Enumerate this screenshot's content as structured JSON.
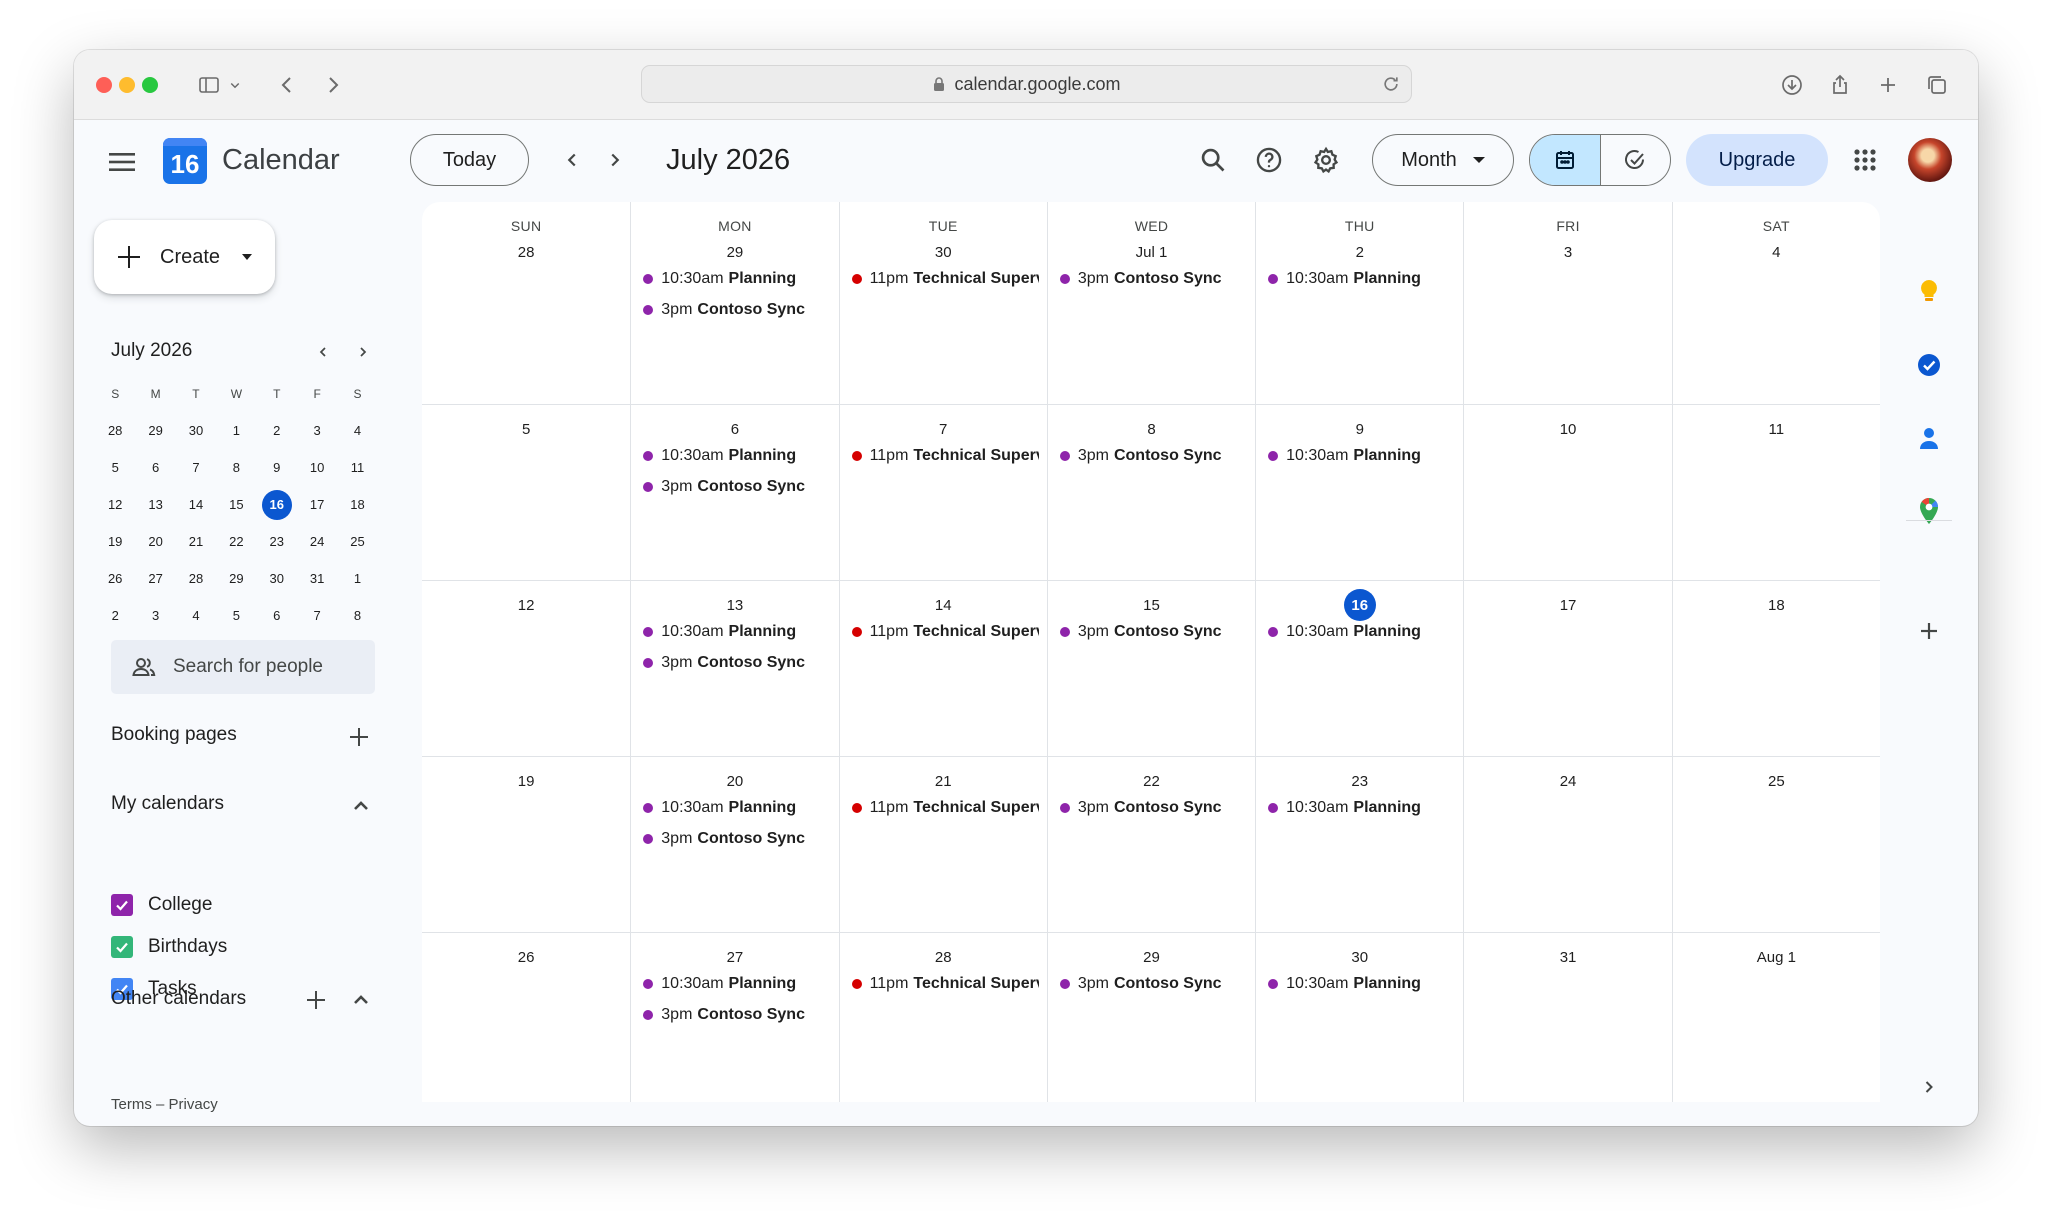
{
  "browser": {
    "url": "calendar.google.com"
  },
  "app": {
    "title": "Calendar",
    "logo_number": "16"
  },
  "header": {
    "today_label": "Today",
    "month_title": "July 2026",
    "view_label": "Month",
    "upgrade_label": "Upgrade"
  },
  "sidebar": {
    "create_label": "Create",
    "mini_month_title": "July 2026",
    "weekdays": [
      "S",
      "M",
      "T",
      "W",
      "T",
      "F",
      "S"
    ],
    "mini_weeks": [
      [
        "28",
        "29",
        "30",
        "1",
        "2",
        "3",
        "4"
      ],
      [
        "5",
        "6",
        "7",
        "8",
        "9",
        "10",
        "11"
      ],
      [
        "12",
        "13",
        "14",
        "15",
        "16",
        "17",
        "18"
      ],
      [
        "19",
        "20",
        "21",
        "22",
        "23",
        "24",
        "25"
      ],
      [
        "26",
        "27",
        "28",
        "29",
        "30",
        "31",
        "1"
      ],
      [
        "2",
        "3",
        "4",
        "5",
        "6",
        "7",
        "8"
      ]
    ],
    "mini_today": "16",
    "search_people_placeholder": "Search for people",
    "booking_pages_label": "Booking pages",
    "my_calendars_label": "My calendars",
    "my_calendars": [
      {
        "name": "College",
        "color": "#8e24aa"
      },
      {
        "name": "Birthdays",
        "color": "#33b679"
      },
      {
        "name": "Tasks",
        "color": "#4285f4"
      }
    ],
    "other_calendars_label": "Other calendars",
    "footer": {
      "terms": "Terms",
      "separator": "–",
      "privacy": "Privacy"
    }
  },
  "colors": {
    "planning": "#8e24aa",
    "contoso": "#8e24aa",
    "technical": "#d50000",
    "today": "#0b57d0"
  },
  "month_grid": {
    "weekday_headers": [
      "SUN",
      "MON",
      "TUE",
      "WED",
      "THU",
      "FRI",
      "SAT"
    ],
    "weeks": [
      [
        {
          "label": "28",
          "events": []
        },
        {
          "label": "29",
          "events": [
            {
              "time": "10:30am",
              "title": "Planning",
              "color": "#8e24aa"
            },
            {
              "time": "3pm",
              "title": "Contoso Sync",
              "color": "#8e24aa"
            }
          ]
        },
        {
          "label": "30",
          "events": [
            {
              "time": "11pm",
              "title": "Technical Superv",
              "color": "#d50000"
            }
          ]
        },
        {
          "label": "Jul 1",
          "events": [
            {
              "time": "3pm",
              "title": "Contoso Sync",
              "color": "#8e24aa"
            }
          ]
        },
        {
          "label": "2",
          "events": [
            {
              "time": "10:30am",
              "title": "Planning",
              "color": "#8e24aa"
            }
          ]
        },
        {
          "label": "3",
          "events": []
        },
        {
          "label": "4",
          "events": []
        }
      ],
      [
        {
          "label": "5",
          "events": []
        },
        {
          "label": "6",
          "events": [
            {
              "time": "10:30am",
              "title": "Planning",
              "color": "#8e24aa"
            },
            {
              "time": "3pm",
              "title": "Contoso Sync",
              "color": "#8e24aa"
            }
          ]
        },
        {
          "label": "7",
          "events": [
            {
              "time": "11pm",
              "title": "Technical Superv",
              "color": "#d50000"
            }
          ]
        },
        {
          "label": "8",
          "events": [
            {
              "time": "3pm",
              "title": "Contoso Sync",
              "color": "#8e24aa"
            }
          ]
        },
        {
          "label": "9",
          "events": [
            {
              "time": "10:30am",
              "title": "Planning",
              "color": "#8e24aa"
            }
          ]
        },
        {
          "label": "10",
          "events": []
        },
        {
          "label": "11",
          "events": []
        }
      ],
      [
        {
          "label": "12",
          "events": []
        },
        {
          "label": "13",
          "events": [
            {
              "time": "10:30am",
              "title": "Planning",
              "color": "#8e24aa"
            },
            {
              "time": "3pm",
              "title": "Contoso Sync",
              "color": "#8e24aa"
            }
          ]
        },
        {
          "label": "14",
          "events": [
            {
              "time": "11pm",
              "title": "Technical Superv",
              "color": "#d50000"
            }
          ]
        },
        {
          "label": "15",
          "events": [
            {
              "time": "3pm",
              "title": "Contoso Sync",
              "color": "#8e24aa"
            }
          ]
        },
        {
          "label": "16",
          "today": true,
          "events": [
            {
              "time": "10:30am",
              "title": "Planning",
              "color": "#8e24aa"
            }
          ]
        },
        {
          "label": "17",
          "events": []
        },
        {
          "label": "18",
          "events": []
        }
      ],
      [
        {
          "label": "19",
          "events": []
        },
        {
          "label": "20",
          "events": [
            {
              "time": "10:30am",
              "title": "Planning",
              "color": "#8e24aa"
            },
            {
              "time": "3pm",
              "title": "Contoso Sync",
              "color": "#8e24aa"
            }
          ]
        },
        {
          "label": "21",
          "events": [
            {
              "time": "11pm",
              "title": "Technical Superv",
              "color": "#d50000"
            }
          ]
        },
        {
          "label": "22",
          "events": [
            {
              "time": "3pm",
              "title": "Contoso Sync",
              "color": "#8e24aa"
            }
          ]
        },
        {
          "label": "23",
          "events": [
            {
              "time": "10:30am",
              "title": "Planning",
              "color": "#8e24aa"
            }
          ]
        },
        {
          "label": "24",
          "events": []
        },
        {
          "label": "25",
          "events": []
        }
      ],
      [
        {
          "label": "26",
          "events": []
        },
        {
          "label": "27",
          "events": [
            {
              "time": "10:30am",
              "title": "Planning",
              "color": "#8e24aa"
            },
            {
              "time": "3pm",
              "title": "Contoso Sync",
              "color": "#8e24aa"
            }
          ]
        },
        {
          "label": "28",
          "events": [
            {
              "time": "11pm",
              "title": "Technical Superv",
              "color": "#d50000"
            }
          ]
        },
        {
          "label": "29",
          "events": [
            {
              "time": "3pm",
              "title": "Contoso Sync",
              "color": "#8e24aa"
            }
          ]
        },
        {
          "label": "30",
          "events": [
            {
              "time": "10:30am",
              "title": "Planning",
              "color": "#8e24aa"
            }
          ]
        },
        {
          "label": "31",
          "events": []
        },
        {
          "label": "Aug 1",
          "events": []
        }
      ]
    ]
  },
  "icons": {
    "sidebar_toggle": "sidebar-icon",
    "search": "search-icon",
    "help": "help-icon",
    "settings": "gear-icon",
    "calendar_view": "calendar-icon",
    "tasks_view": "check-circle-icon",
    "apps": "apps-grid-icon",
    "keep": "keep-icon",
    "tasks": "tasks-icon",
    "contacts": "contacts-icon",
    "maps": "maps-icon"
  }
}
